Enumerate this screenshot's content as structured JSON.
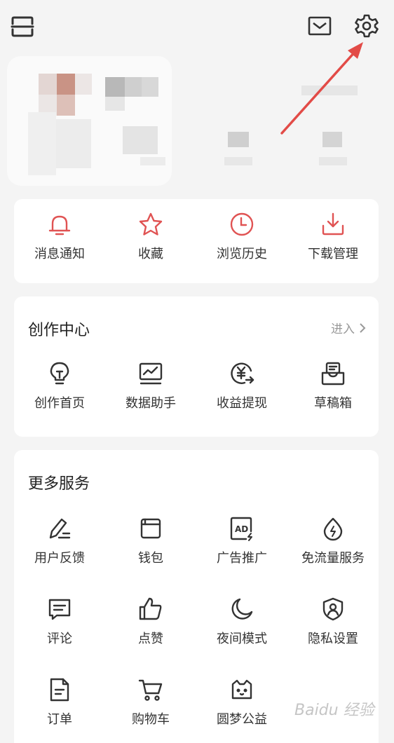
{
  "colors": {
    "accent_red": "#e05353",
    "icon_dark": "#333333",
    "muted": "#999999"
  },
  "header": {
    "left_icon": "scan-icon",
    "mail_icon": "mail-icon",
    "settings_icon": "gear-icon"
  },
  "quick_actions": [
    {
      "label": "消息通知",
      "icon": "bell-icon"
    },
    {
      "label": "收藏",
      "icon": "star-icon"
    },
    {
      "label": "浏览历史",
      "icon": "clock-icon"
    },
    {
      "label": "下载管理",
      "icon": "download-icon"
    }
  ],
  "creation_center": {
    "title": "创作中心",
    "enter_label": "进入",
    "items": [
      {
        "label": "创作首页",
        "icon": "lightbulb-icon"
      },
      {
        "label": "数据助手",
        "icon": "chart-monitor-icon"
      },
      {
        "label": "收益提现",
        "icon": "yuan-withdraw-icon"
      },
      {
        "label": "草稿箱",
        "icon": "draft-box-icon"
      }
    ]
  },
  "more_services": {
    "title": "更多服务",
    "items": [
      {
        "label": "用户反馈",
        "icon": "pen-feedback-icon"
      },
      {
        "label": "钱包",
        "icon": "wallet-icon"
      },
      {
        "label": "广告推广",
        "icon": "ad-icon"
      },
      {
        "label": "免流量服务",
        "icon": "data-free-icon"
      },
      {
        "label": "评论",
        "icon": "comment-icon"
      },
      {
        "label": "点赞",
        "icon": "thumbs-up-icon"
      },
      {
        "label": "夜间模式",
        "icon": "moon-icon"
      },
      {
        "label": "隐私设置",
        "icon": "privacy-shield-icon"
      },
      {
        "label": "订单",
        "icon": "order-doc-icon"
      },
      {
        "label": "购物车",
        "icon": "cart-icon"
      },
      {
        "label": "圆梦公益",
        "icon": "charity-cat-icon"
      }
    ]
  },
  "watermark": "Baidu 经验"
}
